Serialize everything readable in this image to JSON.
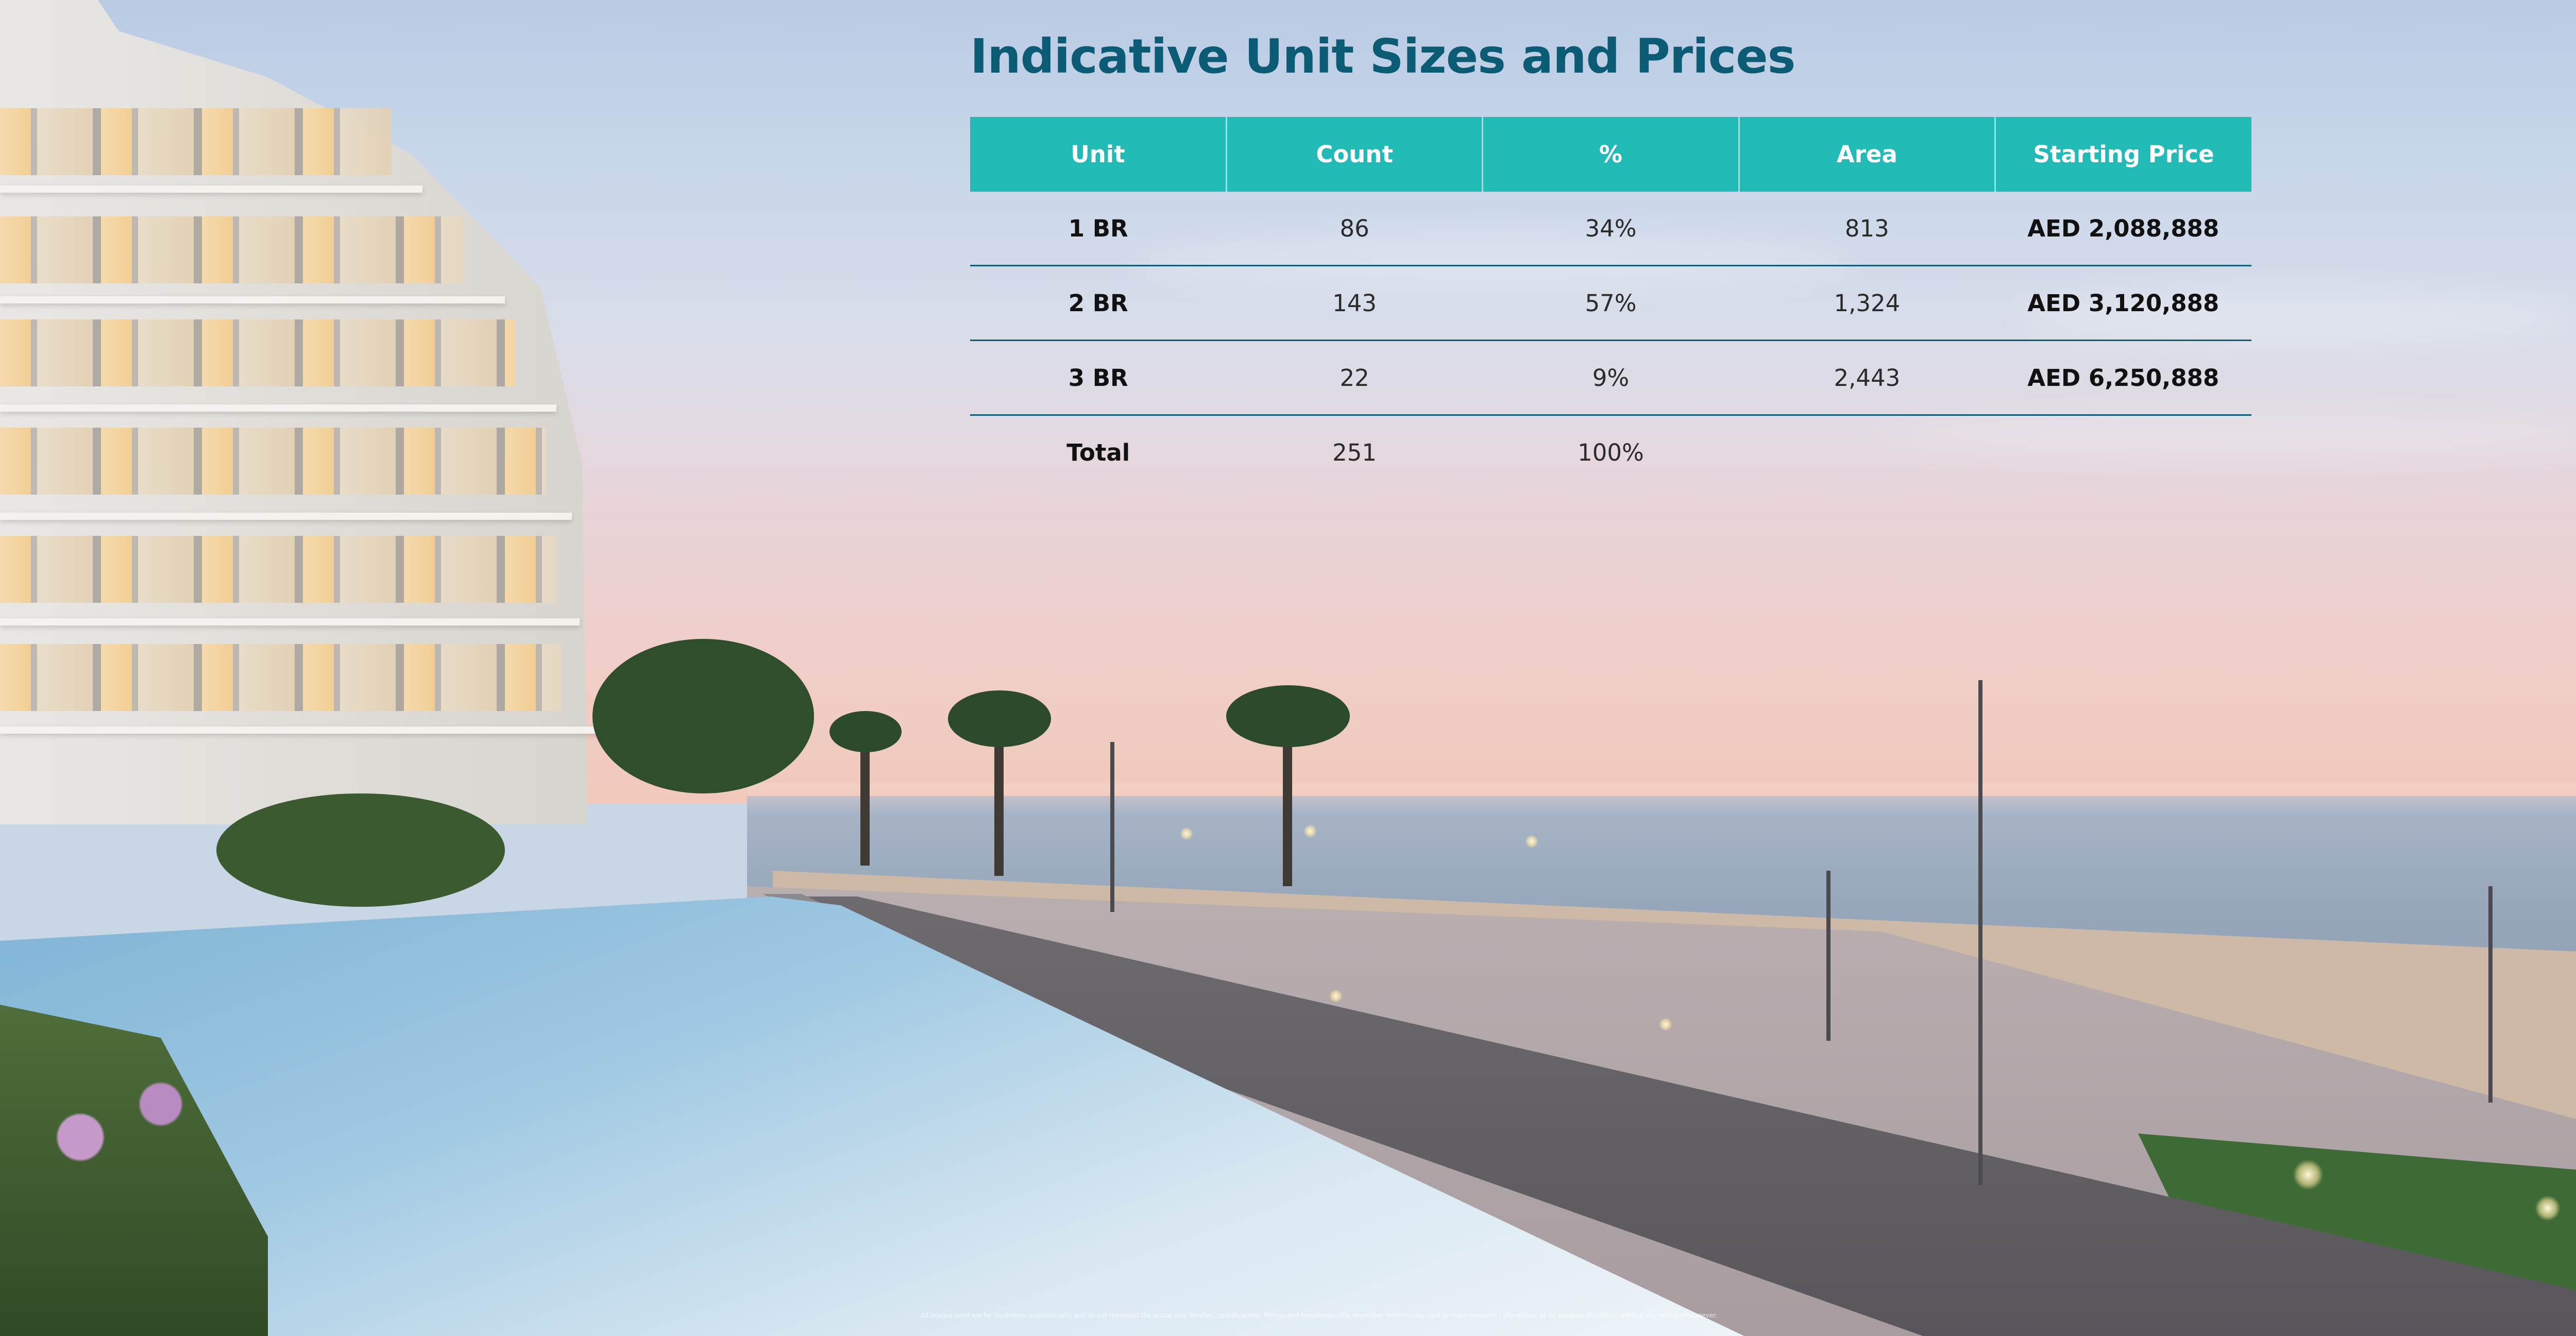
{
  "page": {
    "title": "Indicative Unit Sizes and Prices",
    "disclaimer": "All images used are for illustrative purposes only and do not represent the actual size, finishes, specifications, fittings and furnishings. The developer reserves the right to make revisions / alterations, at its absolute discretion, without any notice whatsoever."
  },
  "table": {
    "headers": [
      "Unit",
      "Count",
      "%",
      "Area",
      "Starting Price"
    ],
    "rows": [
      {
        "unit": "1 BR",
        "count": "86",
        "percent": "34%",
        "area": "813",
        "price": "AED 2,088,888"
      },
      {
        "unit": "2 BR",
        "count": "143",
        "percent": "57%",
        "area": "1,324",
        "price": "AED 3,120,888"
      },
      {
        "unit": "3 BR",
        "count": "22",
        "percent": "9%",
        "area": "2,443",
        "price": "AED 6,250,888"
      }
    ],
    "total": {
      "unit": "Total",
      "count": "251",
      "percent": "100%",
      "area": "",
      "price": ""
    }
  },
  "colors": {
    "title": "#0a5b73",
    "header_background": "#21bab7",
    "header_text": "#ffffff",
    "row_divider": "#0f5f74"
  }
}
